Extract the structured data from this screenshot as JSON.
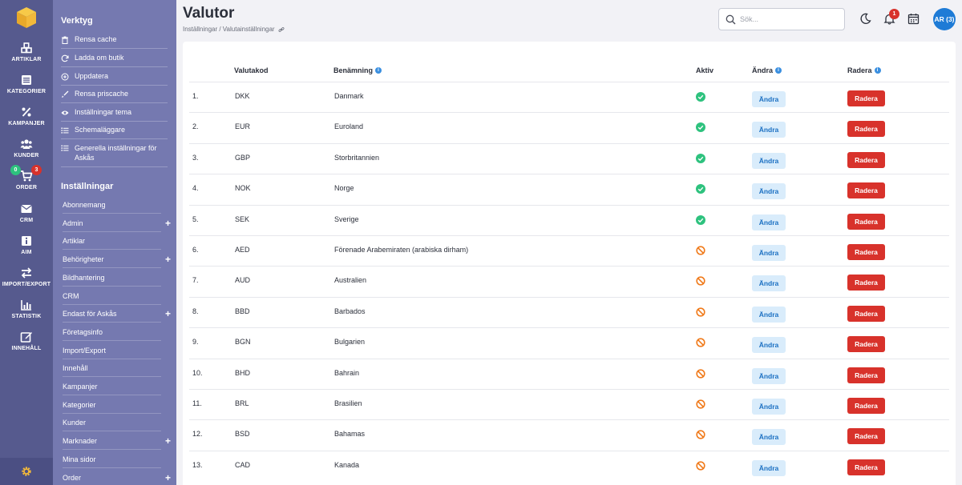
{
  "rail": {
    "items": [
      {
        "label": "ARTIKLAR",
        "icon": "boxes-icon"
      },
      {
        "label": "KATEGORIER",
        "icon": "list-icon"
      },
      {
        "label": "KAMPANJER",
        "icon": "percent-icon"
      },
      {
        "label": "KUNDER",
        "icon": "users-icon"
      },
      {
        "label": "ORDER",
        "icon": "cart-icon"
      },
      {
        "label": "CRM",
        "icon": "mail-icon"
      },
      {
        "label": "AIM",
        "icon": "info-icon"
      },
      {
        "label": "IMPORT/EXPORT",
        "icon": "arrows-icon"
      },
      {
        "label": "STATISTIK",
        "icon": "chart-icon"
      },
      {
        "label": "INNEHÅLL",
        "icon": "edit-icon"
      }
    ],
    "order_badges": {
      "green": "0",
      "red": "3"
    }
  },
  "sidebar": {
    "tools_heading": "Verktyg",
    "tools": [
      {
        "label": "Rensa cache",
        "icon": "trash-icon"
      },
      {
        "label": "Ladda om butik",
        "icon": "refresh-icon"
      },
      {
        "label": "Uppdatera",
        "icon": "plus-circle-icon"
      },
      {
        "label": "Rensa priscache",
        "icon": "brush-icon"
      },
      {
        "label": "Inställningar tema",
        "icon": "eye-icon"
      },
      {
        "label": "Schemaläggare",
        "icon": "list-icon"
      },
      {
        "label": "Generella inställningar för Askås",
        "icon": "list-icon"
      }
    ],
    "settings_heading": "Inställningar",
    "settings": [
      {
        "label": "Abonnemang",
        "plus": ""
      },
      {
        "label": "Admin",
        "plus": "+"
      },
      {
        "label": "Artiklar",
        "plus": ""
      },
      {
        "label": "Behörigheter",
        "plus": "+"
      },
      {
        "label": "Bildhantering",
        "plus": ""
      },
      {
        "label": "CRM",
        "plus": ""
      },
      {
        "label": "Endast för Askås",
        "plus": "+"
      },
      {
        "label": "Företagsinfo",
        "plus": ""
      },
      {
        "label": "Import/Export",
        "plus": ""
      },
      {
        "label": "Innehåll",
        "plus": ""
      },
      {
        "label": "Kampanjer",
        "plus": ""
      },
      {
        "label": "Kategorier",
        "plus": ""
      },
      {
        "label": "Kunder",
        "plus": ""
      },
      {
        "label": "Marknader",
        "plus": "+"
      },
      {
        "label": "Mina sidor",
        "plus": ""
      },
      {
        "label": "Order",
        "plus": "+"
      }
    ]
  },
  "header": {
    "title": "Valutor",
    "breadcrumb": "Inställningar / Valutainställningar",
    "search_placeholder": "Sök...",
    "notifications": "1",
    "avatar": "AR (3)"
  },
  "table": {
    "columns": [
      "Valutakod",
      "Benämning",
      "Aktiv",
      "Ändra",
      "Radera"
    ],
    "edit_label": "Ändra",
    "delete_label": "Radera",
    "colors": {
      "active": "#2ec27e",
      "inactive": "#f07a1a",
      "delete": "#d8322b",
      "edit_bg": "#d9ecfb"
    },
    "rows": [
      {
        "num": "1.",
        "code": "DKK",
        "name": "Danmark",
        "active": true
      },
      {
        "num": "2.",
        "code": "EUR",
        "name": "Euroland",
        "active": true
      },
      {
        "num": "3.",
        "code": "GBP",
        "name": "Storbritannien",
        "active": true
      },
      {
        "num": "4.",
        "code": "NOK",
        "name": "Norge",
        "active": true
      },
      {
        "num": "5.",
        "code": "SEK",
        "name": "Sverige",
        "active": true
      },
      {
        "num": "6.",
        "code": "AED",
        "name": "Förenade Arabemiraten (arabiska dirham)",
        "active": false
      },
      {
        "num": "7.",
        "code": "AUD",
        "name": "Australien",
        "active": false
      },
      {
        "num": "8.",
        "code": "BBD",
        "name": "Barbados",
        "active": false
      },
      {
        "num": "9.",
        "code": "BGN",
        "name": "Bulgarien",
        "active": false
      },
      {
        "num": "10.",
        "code": "BHD",
        "name": "Bahrain",
        "active": false
      },
      {
        "num": "11.",
        "code": "BRL",
        "name": "Brasilien",
        "active": false
      },
      {
        "num": "12.",
        "code": "BSD",
        "name": "Bahamas",
        "active": false
      },
      {
        "num": "13.",
        "code": "CAD",
        "name": "Kanada",
        "active": false
      }
    ]
  }
}
